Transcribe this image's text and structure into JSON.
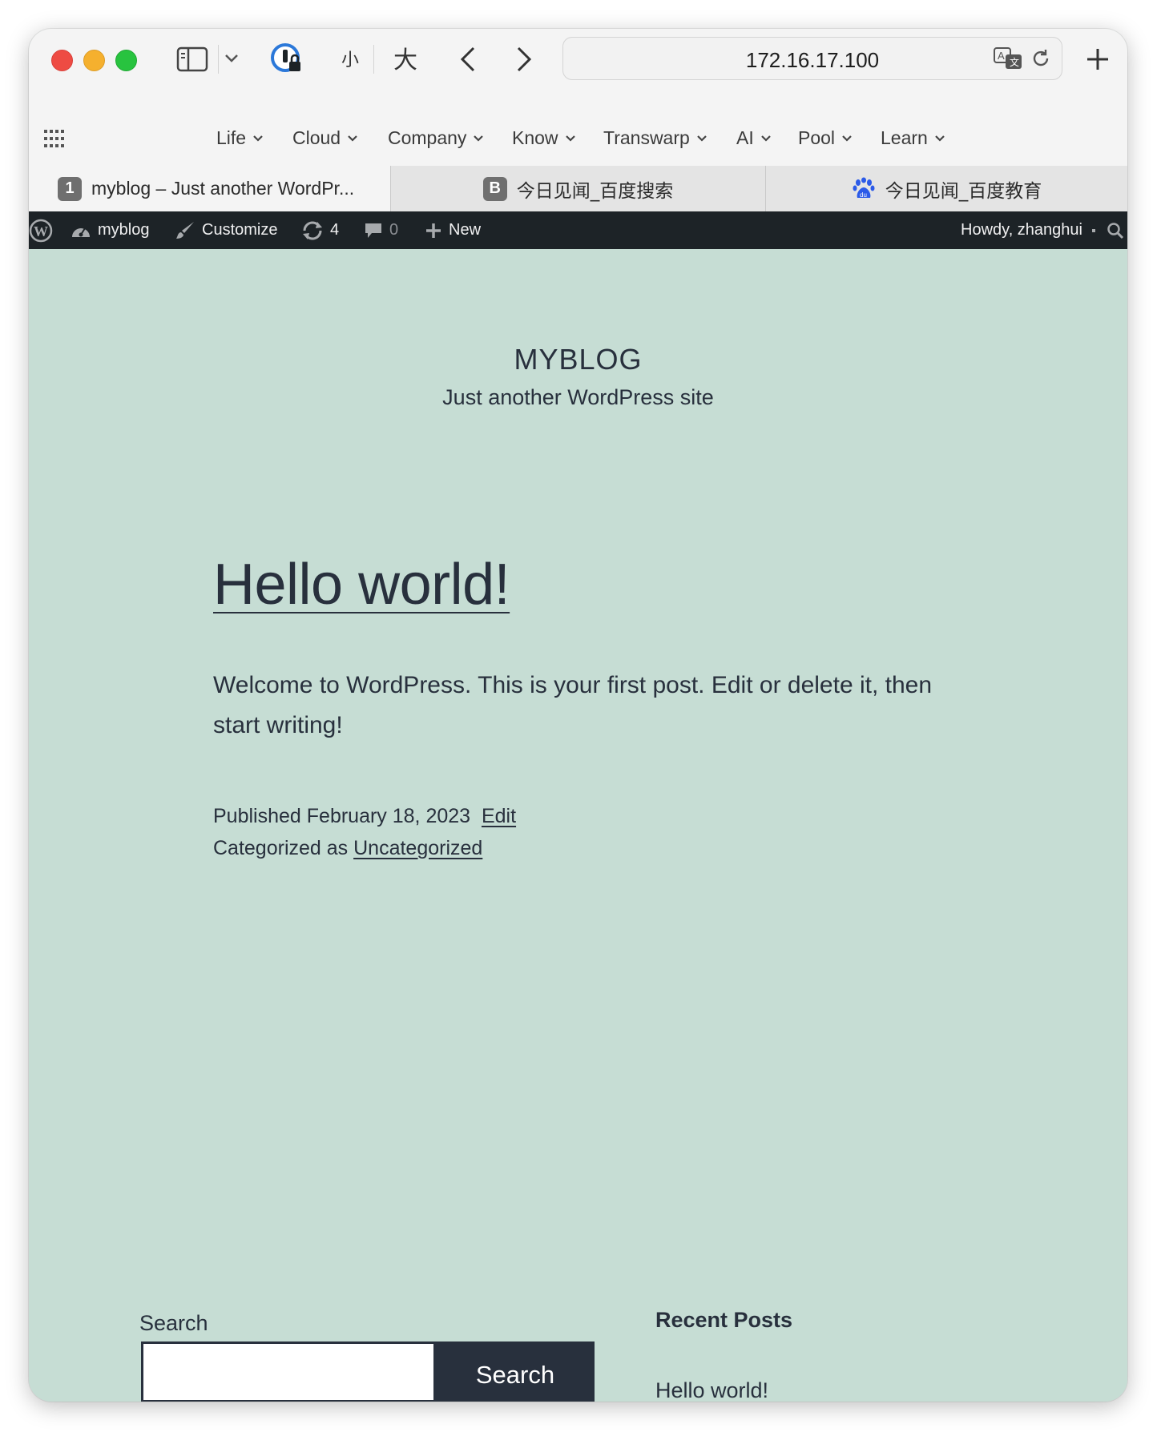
{
  "browser": {
    "address": "172.16.17.100",
    "text_size_small": "小",
    "text_size_large": "大",
    "bookmarks": [
      "Life",
      "Cloud",
      "Company",
      "Know",
      "Transwarp",
      "AI",
      "Pool",
      "Learn"
    ],
    "tabs": [
      {
        "badge": "1",
        "label": "myblog – Just another WordPr..."
      },
      {
        "badge": "B",
        "label": "今日见闻_百度搜索"
      },
      {
        "badge": "du",
        "label": "今日见闻_百度教育"
      }
    ],
    "colors": {
      "close": "#ee4b43",
      "minimize": "#f5b02e",
      "zoom": "#28c33f",
      "baidu_blue": "#2b5ae8"
    }
  },
  "adminbar": {
    "site": "myblog",
    "customize": "Customize",
    "updates": "4",
    "comments": "0",
    "new": "New",
    "greeting": "Howdy, zhanghui"
  },
  "site": {
    "title": "MYBLOG",
    "description": "Just another WordPress site",
    "background": "#c6ddd4"
  },
  "post": {
    "title": "Hello world!",
    "body": "Welcome to WordPress. This is your first post. Edit or delete it, then start writing!",
    "published_prefix": "Published",
    "published_date": "February 18, 2023",
    "edit": "Edit",
    "categorized_prefix": "Categorized as",
    "category": "Uncategorized"
  },
  "footer": {
    "search_label": "Search",
    "search_value": "",
    "search_button": "Search",
    "recent_posts_title": "Recent Posts",
    "recent_posts": [
      "Hello world!"
    ]
  }
}
